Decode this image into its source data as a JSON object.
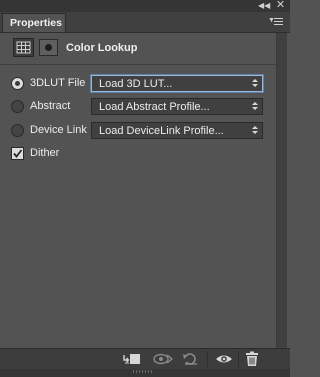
{
  "panel": {
    "tab_label": "Properties",
    "title": "Color Lookup"
  },
  "options": [
    {
      "label": "3DLUT File",
      "select_value": "Load 3D LUT...",
      "selected": true
    },
    {
      "label": "Abstract",
      "select_value": "Load Abstract Profile...",
      "selected": false
    },
    {
      "label": "Device Link",
      "select_value": "Load DeviceLink Profile...",
      "selected": false
    }
  ],
  "dither": {
    "label": "Dither",
    "checked": true
  },
  "icons": {
    "collapse": "double-chevron-left-icon",
    "close": "close-icon",
    "panel_menu": "panel-menu-icon",
    "adjustment": "adjustment-grid-icon",
    "mask": "layer-mask-icon",
    "clip": "clip-to-layer-icon",
    "view_previous": "view-previous-state-icon",
    "reset": "reset-icon",
    "visibility": "eye-icon",
    "delete": "trash-icon"
  },
  "colors": {
    "panel_bg": "#535353",
    "focus_ring": "#9bb8d8"
  }
}
